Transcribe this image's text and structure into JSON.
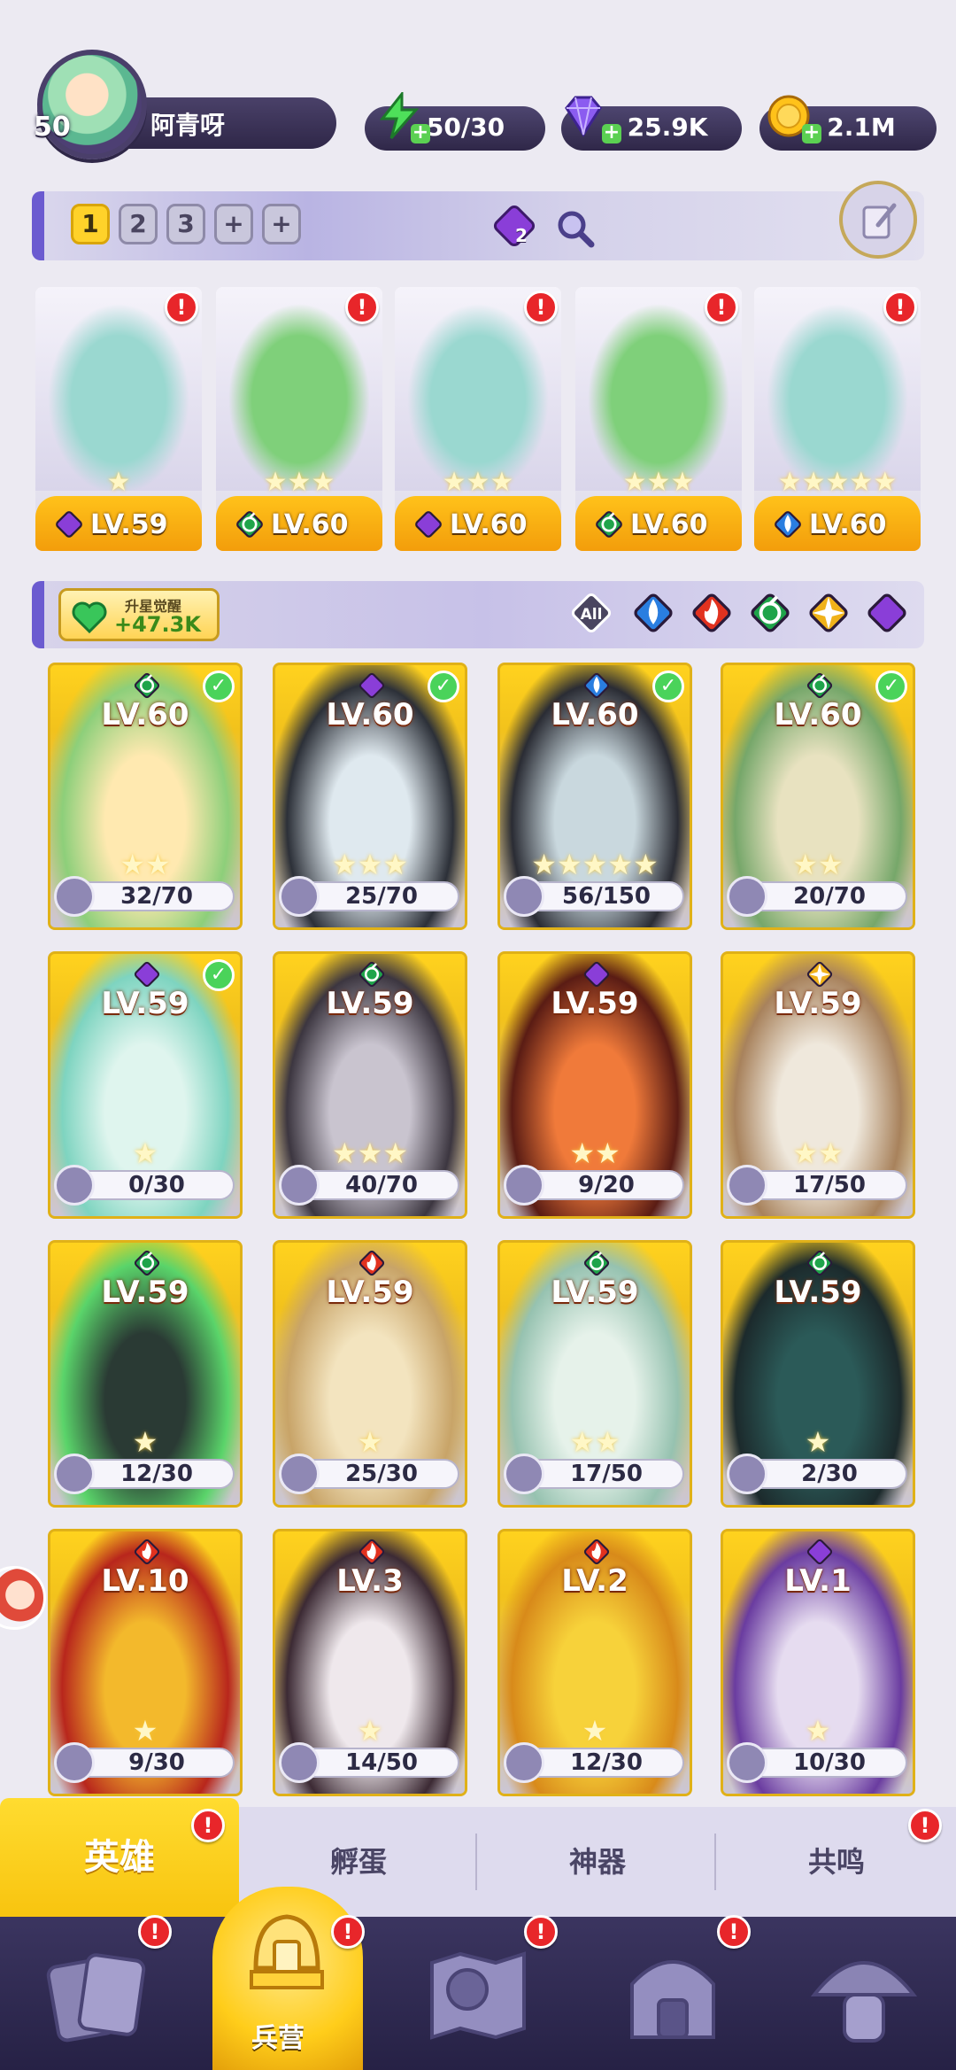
{
  "player": {
    "level": "50",
    "name": "阿青呀"
  },
  "resources": {
    "energy": "50/30",
    "gems": "25.9K",
    "gold": "2.1M"
  },
  "team_tabs": [
    "1",
    "2",
    "3",
    "+",
    "+"
  ],
  "team_tab_active": "1",
  "awaken_badge": "2",
  "team": [
    {
      "element": "moon",
      "level": "LV.59",
      "stars": "★"
    },
    {
      "element": "leaf",
      "level": "LV.60",
      "stars": "★★★"
    },
    {
      "element": "moon",
      "level": "LV.60",
      "stars": "★★★"
    },
    {
      "element": "leaf",
      "level": "LV.60",
      "stars": "★★★"
    },
    {
      "element": "water",
      "level": "LV.60",
      "stars": "★★★★★"
    }
  ],
  "awaken": {
    "title": "升星觉醒",
    "value": "+47.3K"
  },
  "filters": {
    "all_label": "All",
    "elements": [
      "water",
      "fire",
      "leaf",
      "light",
      "moon"
    ]
  },
  "heroes": [
    {
      "element": "leaf",
      "level": "LV.60",
      "shards": "32/70",
      "checked": true,
      "stars": "★★",
      "theme": [
        "#ffe9b0",
        "#8dcf7a"
      ]
    },
    {
      "element": "moon",
      "level": "LV.60",
      "shards": "25/70",
      "checked": true,
      "stars": "★★★",
      "theme": [
        "#dfe9ef",
        "#2c3038"
      ]
    },
    {
      "element": "water",
      "level": "LV.60",
      "shards": "56/150",
      "checked": true,
      "stars": "★★★★★",
      "theme": [
        "#c9d8de",
        "#2a2c34"
      ]
    },
    {
      "element": "leaf",
      "level": "LV.60",
      "shards": "20/70",
      "checked": true,
      "stars": "★★",
      "theme": [
        "#e8e2c0",
        "#76a76a"
      ]
    },
    {
      "element": "moon",
      "level": "LV.59",
      "shards": "0/30",
      "checked": true,
      "stars": "★",
      "theme": [
        "#dff5ee",
        "#7ed4c0"
      ]
    },
    {
      "element": "leaf",
      "level": "LV.59",
      "shards": "40/70",
      "checked": false,
      "stars": "★★★",
      "theme": [
        "#c9c4cf",
        "#3c3640"
      ]
    },
    {
      "element": "moon",
      "level": "LV.59",
      "shards": "9/20",
      "checked": false,
      "stars": "★★",
      "theme": [
        "#f07a3a",
        "#5a1c14"
      ]
    },
    {
      "element": "light",
      "level": "LV.59",
      "shards": "17/50",
      "checked": false,
      "stars": "★★",
      "theme": [
        "#efe8dc",
        "#a8825c"
      ]
    },
    {
      "element": "leaf",
      "level": "LV.59",
      "shards": "12/30",
      "checked": false,
      "stars": "★",
      "theme": [
        "#2a3a34",
        "#5ad46a"
      ]
    },
    {
      "element": "fire",
      "level": "LV.59",
      "shards": "25/30",
      "checked": false,
      "stars": "★",
      "theme": [
        "#f3e4bf",
        "#c8a468"
      ]
    },
    {
      "element": "leaf",
      "level": "LV.59",
      "shards": "17/50",
      "checked": false,
      "stars": "★★",
      "theme": [
        "#e6f2ea",
        "#96c2b0"
      ]
    },
    {
      "element": "leaf",
      "level": "LV.59",
      "shards": "2/30",
      "checked": false,
      "stars": "★",
      "theme": [
        "#2b5a58",
        "#1c2a2c"
      ]
    },
    {
      "element": "fire",
      "level": "LV.10",
      "shards": "9/30",
      "checked": false,
      "stars": "★",
      "theme": [
        "#f3b92c",
        "#b8261c"
      ]
    },
    {
      "element": "fire",
      "level": "LV.3",
      "shards": "14/50",
      "checked": false,
      "stars": "★",
      "theme": [
        "#efe8ec",
        "#3c2a34"
      ]
    },
    {
      "element": "fire",
      "level": "LV.2",
      "shards": "12/30",
      "checked": false,
      "stars": "★",
      "theme": [
        "#f7d23a",
        "#d88a1a"
      ]
    },
    {
      "element": "moon",
      "level": "LV.1",
      "shards": "10/30",
      "checked": false,
      "stars": "★",
      "theme": [
        "#e6dcf0",
        "#6a3ca0"
      ]
    }
  ],
  "tabs": [
    "英雄",
    "孵蛋",
    "神器",
    "共鸣"
  ],
  "nav": {
    "active_label": "兵营"
  },
  "colors": {
    "moon": "#8a3ed8",
    "leaf": "#1fa44a",
    "water": "#2a7ee0",
    "fire": "#e2321f",
    "light": "#f0b21a",
    "accent": "#ffd22a"
  }
}
